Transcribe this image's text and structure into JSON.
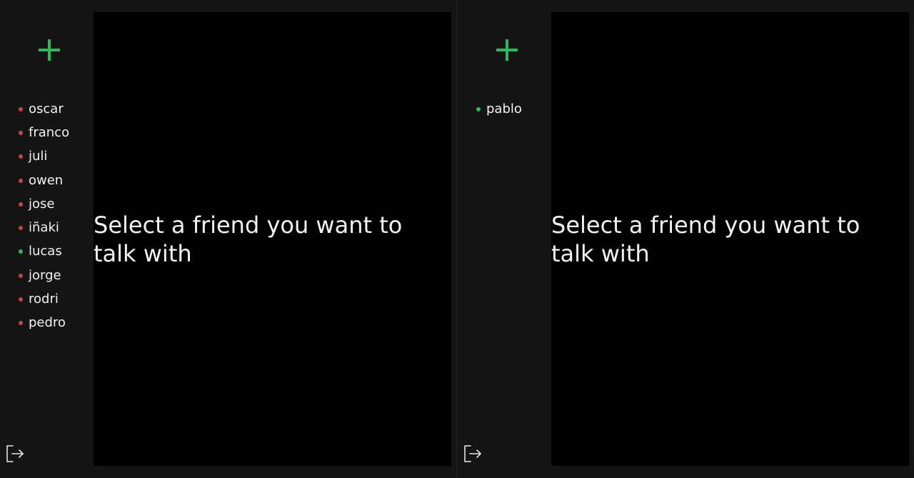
{
  "colors": {
    "accent_green": "#2fb863",
    "online": "#2fb863",
    "offline": "#c84646"
  },
  "icons": {
    "add": "plus-icon",
    "logout": "logout-icon"
  },
  "panes": [
    {
      "friends": [
        {
          "name": "oscar",
          "status": "offline"
        },
        {
          "name": "franco",
          "status": "offline"
        },
        {
          "name": "juli",
          "status": "offline"
        },
        {
          "name": "owen",
          "status": "offline"
        },
        {
          "name": "jose",
          "status": "offline"
        },
        {
          "name": "iñaki",
          "status": "offline"
        },
        {
          "name": "lucas",
          "status": "online"
        },
        {
          "name": "jorge",
          "status": "offline"
        },
        {
          "name": "rodri",
          "status": "offline"
        },
        {
          "name": "pedro",
          "status": "offline"
        }
      ],
      "placeholder": "Select a friend you want to talk with"
    },
    {
      "friends": [
        {
          "name": "pablo",
          "status": "online"
        }
      ],
      "placeholder": "Select a friend you want to talk with"
    }
  ]
}
